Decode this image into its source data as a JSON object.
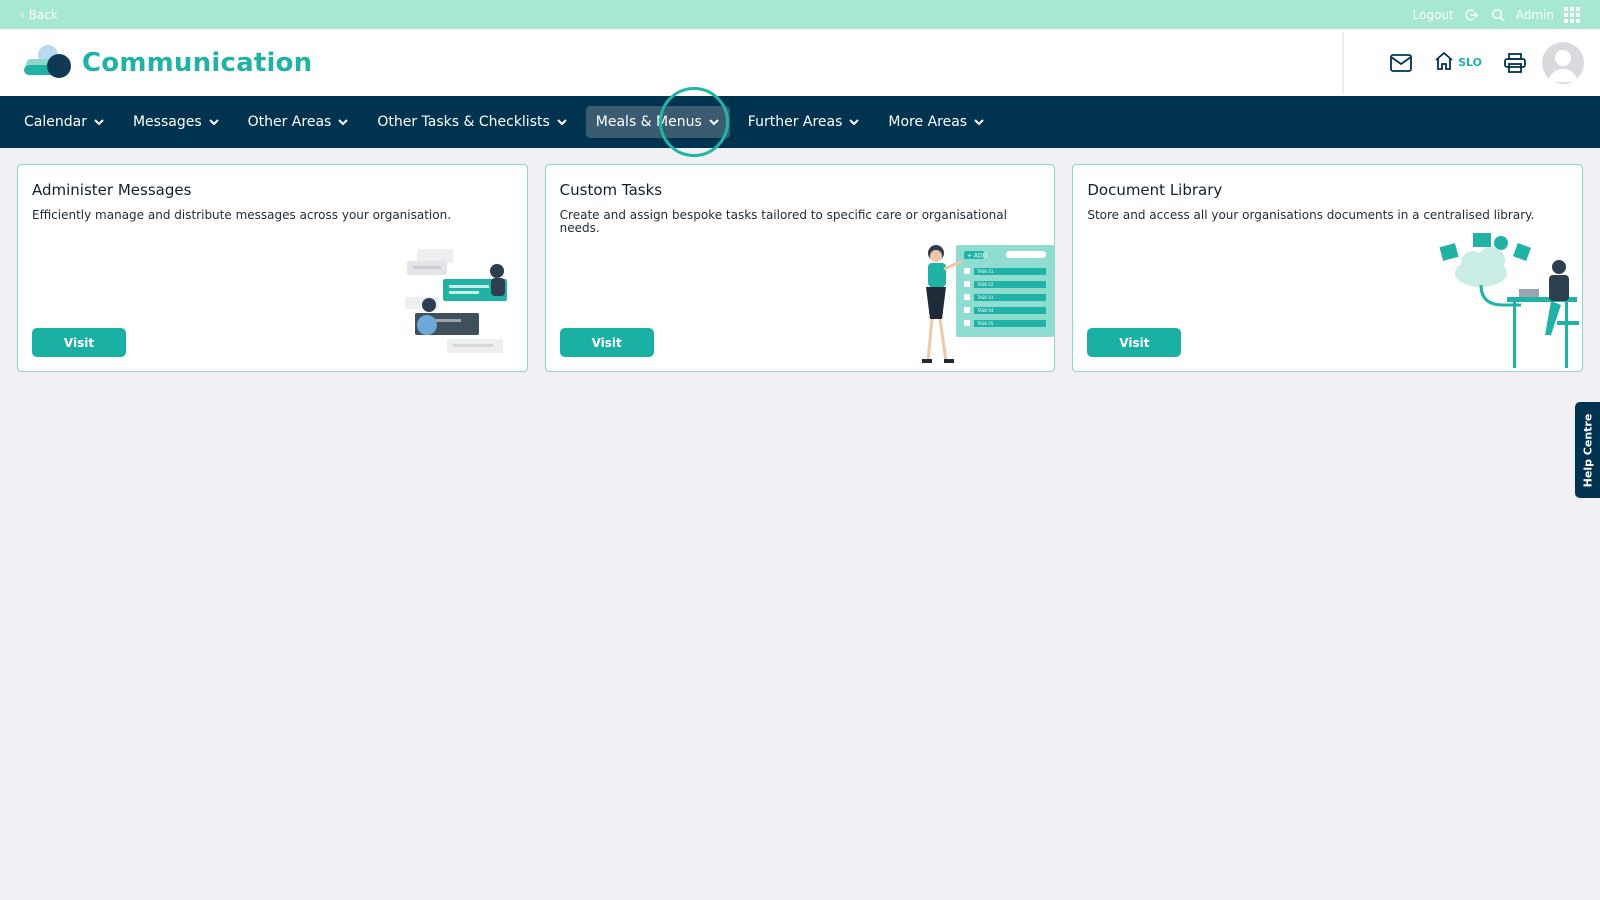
{
  "topbar": {
    "back_label": "‹ Back",
    "logout_label": "Logout",
    "admin_label": "Admin"
  },
  "header": {
    "title": "Communication",
    "home_label": "SLO"
  },
  "nav": {
    "items": [
      {
        "label": "Calendar"
      },
      {
        "label": "Messages"
      },
      {
        "label": "Other Areas"
      },
      {
        "label": "Other Tasks & Checklists"
      },
      {
        "label": "Meals & Menus"
      },
      {
        "label": "Further Areas"
      },
      {
        "label": "More Areas"
      }
    ],
    "active_index": 4
  },
  "cards": [
    {
      "title": "Administer Messages",
      "description": "Efficiently manage and distribute messages across your organisation.",
      "button_label": "Visit"
    },
    {
      "title": "Custom Tasks",
      "description": "Create and assign bespoke tasks tailored to specific care or organisational needs.",
      "button_label": "Visit",
      "illustration_text": [
        "+ ADD",
        "TASK 01",
        "TASK 02",
        "TASK 03",
        "TASK 04",
        "TASK 05"
      ]
    },
    {
      "title": "Document Library",
      "description": "Store and access all your organisations documents in a centralised library.",
      "button_label": "Visit"
    }
  ],
  "help_tab": {
    "label": "Help Centre"
  },
  "colors": {
    "accent": "#20b3a5",
    "topbar": "#a6e8d1",
    "nav": "#00334f",
    "nav_active": "#3a5b70",
    "page_bg": "#f1f1f5"
  },
  "icons": {
    "logo": "cloud-logo-icon",
    "logout": "logout-icon",
    "search": "search-icon",
    "apps": "grid-icon",
    "mail": "mail-icon",
    "home": "home-icon",
    "print": "printer-icon",
    "avatar": "user-avatar-icon",
    "chevron": "chevron-down-icon"
  }
}
